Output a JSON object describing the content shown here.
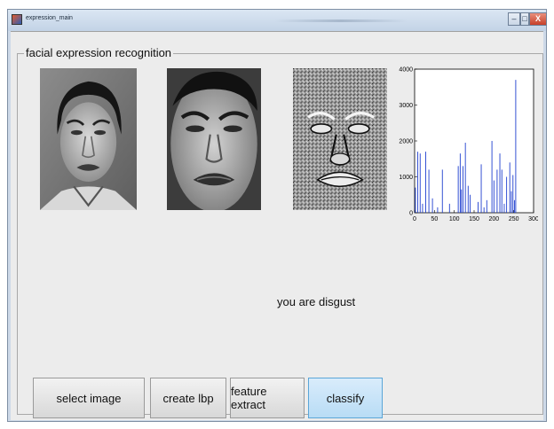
{
  "window": {
    "title": "expression_main",
    "minimize_symbol": "–",
    "maximize_symbol": "□",
    "close_symbol": "X"
  },
  "panel": {
    "title": "facial expression recognition"
  },
  "images": {
    "original_icon": "face-photo",
    "cropped_icon": "face-photo",
    "lbp_icon": "lbp-texture"
  },
  "histogram": {
    "chart_data": {
      "type": "bar",
      "color": "#1f3fcf",
      "x_ticks": [
        0,
        50,
        100,
        150,
        200,
        250,
        300
      ],
      "y_ticks": [
        0,
        1000,
        2000,
        3000,
        4000
      ],
      "xlim": [
        0,
        300
      ],
      "ylim": [
        0,
        4000
      ],
      "x": [
        2,
        8,
        14,
        20,
        28,
        36,
        45,
        58,
        70,
        88,
        110,
        115,
        118,
        122,
        128,
        135,
        140,
        160,
        168,
        175,
        182,
        195,
        200,
        208,
        215,
        220,
        226,
        232,
        240,
        244,
        248,
        252,
        255
      ],
      "values": [
        700,
        1700,
        1650,
        250,
        1700,
        1200,
        400,
        150,
        1200,
        250,
        1300,
        1650,
        650,
        1300,
        1950,
        750,
        500,
        300,
        1350,
        150,
        350,
        2000,
        900,
        1200,
        1650,
        1200,
        250,
        1000,
        1400,
        600,
        1050,
        350,
        3700
      ]
    }
  },
  "result": {
    "text": "you are disgust"
  },
  "buttons": {
    "select": "select image",
    "lbp": "create  lbp",
    "extract": "feature extract",
    "classify": "classify"
  }
}
